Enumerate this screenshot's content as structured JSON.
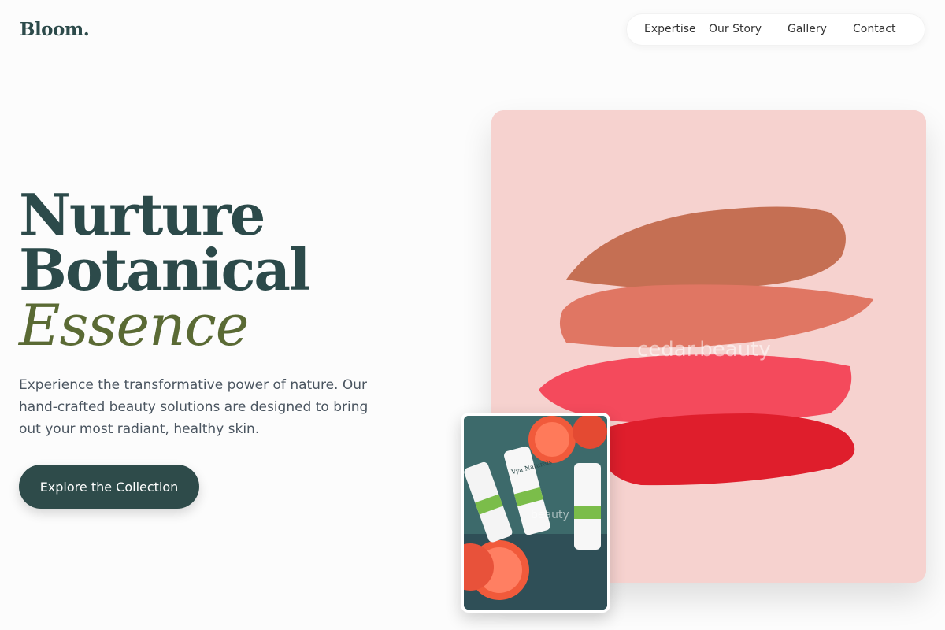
{
  "header": {
    "logo": "Bloom.",
    "nav": [
      "Expertise",
      "Our Story",
      "Gallery",
      "Contact"
    ]
  },
  "hero": {
    "title_line1": "Nurture",
    "title_line2": "Botanical",
    "title_accent": "Essence",
    "subtitle": "Experience the transformative power of nature. Our hand-crafted beauty solutions are designed to bring out your most radiant, healthy skin.",
    "cta_label": "Explore the Collection"
  },
  "images": {
    "main_watermark": "cedar.beauty",
    "thumb_watermark": "beauty",
    "bottle_label": "Vya Naturals"
  },
  "colors": {
    "primary": "#2e4b4a",
    "accent": "#5a6a34",
    "image_bg": "#f6d2cf"
  }
}
